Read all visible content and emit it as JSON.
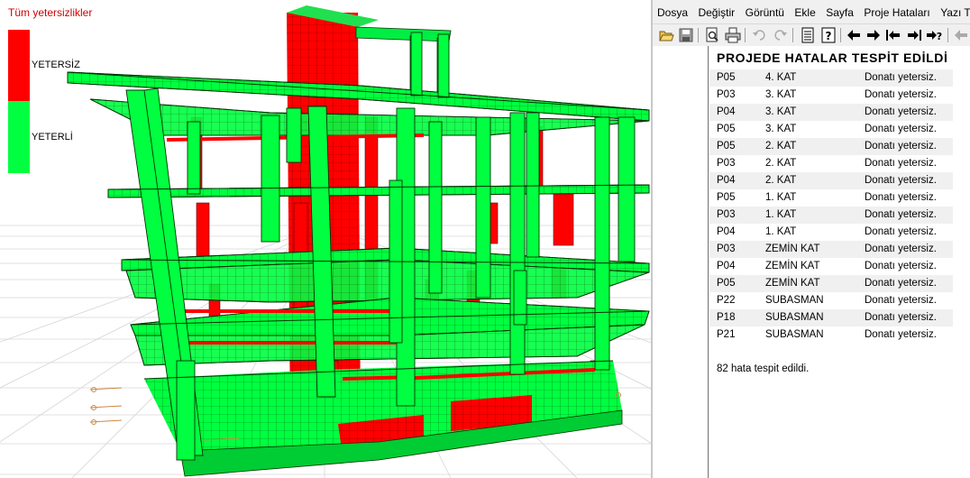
{
  "viewport": {
    "legend": {
      "title": "Tüm yetersizlikler",
      "items": [
        {
          "label": "YETERSİZ",
          "color": "#ff0000"
        },
        {
          "label": "YETERLİ",
          "color": "#00ff40"
        }
      ]
    },
    "colors": {
      "insufficient": "#ff0000",
      "sufficient": "#00ff40",
      "outline": "#003300"
    }
  },
  "report": {
    "menu": [
      "Dosya",
      "Değiştir",
      "Görüntü",
      "Ekle",
      "Sayfa",
      "Proje Hataları",
      "Yazı T"
    ],
    "toolbar": [
      "open-icon",
      "save-icon",
      "print-preview-icon",
      "print-icon",
      "undo-icon",
      "redo-icon",
      "table-icon",
      "help-icon",
      "arrow-left-icon",
      "arrow-right-icon",
      "first-icon",
      "last-icon",
      "goto-icon",
      "back-icon"
    ],
    "title": "PROJEDE HATALAR TESPİT EDİLDİ",
    "errors": [
      {
        "code": "P05",
        "floor": "4. KAT",
        "message": "Donatı yetersiz."
      },
      {
        "code": "P03",
        "floor": "3. KAT",
        "message": "Donatı yetersiz."
      },
      {
        "code": "P04",
        "floor": "3. KAT",
        "message": "Donatı yetersiz."
      },
      {
        "code": "P05",
        "floor": "3. KAT",
        "message": "Donatı yetersiz."
      },
      {
        "code": "P05",
        "floor": "2. KAT",
        "message": "Donatı yetersiz."
      },
      {
        "code": "P03",
        "floor": "2. KAT",
        "message": "Donatı yetersiz."
      },
      {
        "code": "P04",
        "floor": "2. KAT",
        "message": "Donatı yetersiz."
      },
      {
        "code": "P05",
        "floor": "1. KAT",
        "message": "Donatı yetersiz."
      },
      {
        "code": "P03",
        "floor": "1. KAT",
        "message": "Donatı yetersiz."
      },
      {
        "code": "P04",
        "floor": "1. KAT",
        "message": "Donatı yetersiz."
      },
      {
        "code": "P03",
        "floor": "ZEMİN KAT",
        "message": "Donatı yetersiz."
      },
      {
        "code": "P04",
        "floor": "ZEMİN KAT",
        "message": "Donatı yetersiz."
      },
      {
        "code": "P05",
        "floor": "ZEMİN KAT",
        "message": "Donatı yetersiz."
      },
      {
        "code": "P22",
        "floor": "SUBASMAN",
        "message": "Donatı yetersiz."
      },
      {
        "code": "P18",
        "floor": "SUBASMAN",
        "message": "Donatı yetersiz."
      },
      {
        "code": "P21",
        "floor": "SUBASMAN",
        "message": "Donatı yetersiz."
      }
    ],
    "summary": "82 hata tespit edildi."
  }
}
